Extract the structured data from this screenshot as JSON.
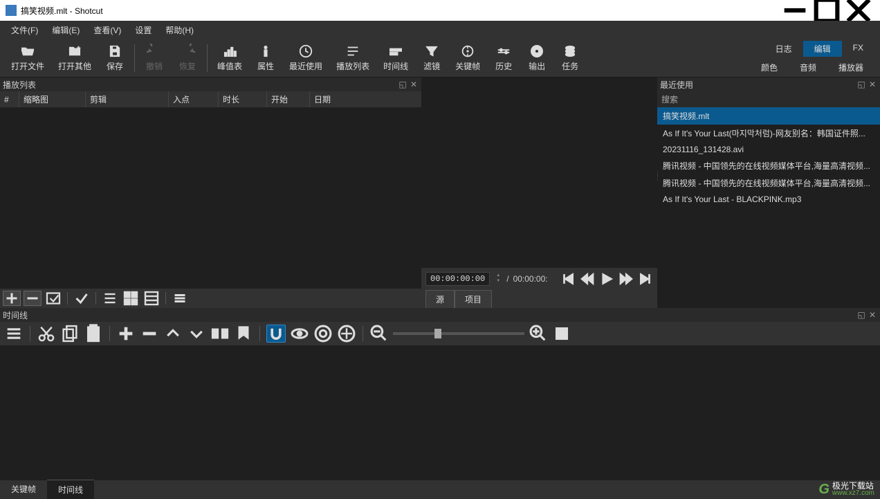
{
  "window": {
    "title": "搞笑视频.mlt - Shotcut"
  },
  "menubar": [
    {
      "label": "文件(F)"
    },
    {
      "label": "编辑(E)"
    },
    {
      "label": "查看(V)"
    },
    {
      "label": "设置"
    },
    {
      "label": "帮助(H)"
    }
  ],
  "toolbar": {
    "open_file": "打开文件",
    "open_other": "打开其他",
    "save": "保存",
    "undo": "撤销",
    "redo": "恢复",
    "peak_meter": "峰值表",
    "properties": "属性",
    "recent": "最近使用",
    "playlist": "播放列表",
    "timeline": "时间线",
    "filters": "滤镜",
    "keyframes": "关键帧",
    "history": "历史",
    "export": "输出",
    "jobs": "任务"
  },
  "right_tabs_row1": [
    {
      "label": "日志",
      "active": false
    },
    {
      "label": "编辑",
      "active": true
    },
    {
      "label": "FX",
      "active": false
    }
  ],
  "right_tabs_row2": [
    {
      "label": "颜色"
    },
    {
      "label": "音频"
    },
    {
      "label": "播放器"
    }
  ],
  "playlist_panel": {
    "title": "播放列表",
    "columns": {
      "num": "#",
      "thumb": "缩略图",
      "clip": "剪辑",
      "in": "入点",
      "dur": "时长",
      "start": "开始",
      "date": "日期"
    }
  },
  "transport": {
    "current_time": "00:00:00:00",
    "slash": "/",
    "total_time": "00:00:00:"
  },
  "source_tabs": {
    "source": "源",
    "project": "项目"
  },
  "recent_panel": {
    "title": "最近使用",
    "search_label": "搜索",
    "items": [
      {
        "label": "搞笑视频.mlt",
        "selected": true
      },
      {
        "label": "As If It's Your Last(마지막처럼)-网友别名：韩国证件照...",
        "selected": false
      },
      {
        "label": "20231116_131428.avi",
        "selected": false
      },
      {
        "label": "腾讯视频 - 中国领先的在线视频媒体平台,海量高清视频...",
        "selected": false
      },
      {
        "label": "腾讯视频 - 中国领先的在线视频媒体平台,海量高清视频...",
        "selected": false
      },
      {
        "label": "As If It's Your Last - BLACKPINK.mp3",
        "selected": false
      }
    ]
  },
  "timeline_panel": {
    "title": "时间线"
  },
  "bottom_tabs": [
    {
      "label": "关键帧",
      "active": false
    },
    {
      "label": "时间线",
      "active": true
    }
  ],
  "watermark": {
    "cn": "极光下载站",
    "url": "www.xz7.com"
  }
}
